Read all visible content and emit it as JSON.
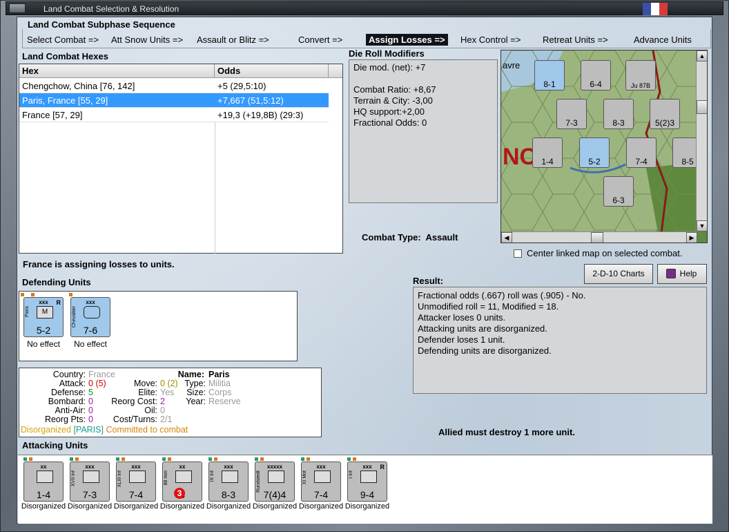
{
  "window": {
    "title": "Land Combat Selection & Resolution"
  },
  "subphase": {
    "heading": "Land Combat Subphase Sequence",
    "steps": [
      "Select Combat =>",
      "Att Snow Units =>",
      "Assault or Blitz =>",
      "Convert =>",
      "Assign Losses =>",
      "Hex Control =>",
      "Retreat Units =>",
      "Advance Units"
    ],
    "active_step": "Assign Losses =>"
  },
  "hexes": {
    "heading": "Land Combat Hexes",
    "columns": [
      "Hex",
      "Odds"
    ],
    "rows": [
      {
        "hex": "Chengchow, China [76, 142]",
        "odds": "+5 (29,5:10)"
      },
      {
        "hex": "Paris, France [55, 29]",
        "odds": "+7,667 (51,5:12)",
        "selected": true
      },
      {
        "hex": "France [57, 29]",
        "odds": "+19,3 (+19,8B) (29:3)"
      }
    ]
  },
  "modifiers": {
    "heading": "Die Roll Modifiers",
    "lines": [
      "Die mod. (net): +7",
      "",
      "Combat Ratio: +8,67",
      "Terrain & City: -3,00",
      "HQ support:+2,00",
      "Fractional Odds: 0"
    ]
  },
  "combat_type": {
    "label": "Combat Type:",
    "value": "Assault"
  },
  "center_map": {
    "label": "Center linked map on selected combat.",
    "checked": false
  },
  "assigning_text": "France is assigning losses to units.",
  "defending": {
    "heading": "Defending Units",
    "units": [
      {
        "size": "xxx",
        "name": "Paris",
        "vals": "5-2",
        "status": "No effect",
        "r": "R",
        "inner": "M"
      },
      {
        "size": "xxx",
        "name": "Chevallier",
        "vals": "7-6",
        "status": "No effect",
        "r": "",
        "inner": ""
      }
    ]
  },
  "unit_info": {
    "country_label": "Country:",
    "country": "France",
    "attack_label": "Attack:",
    "attack": "0",
    "attack_paren": "(5)",
    "defense_label": "Defense:",
    "defense": "5",
    "bombard_label": "Bombard:",
    "bombard": "0",
    "antiair_label": "Anti-Air:",
    "antiair": "0",
    "reorg_pts_label": "Reorg Pts:",
    "reorg_pts": "0",
    "name_label": "Name:",
    "name": "Paris",
    "move_label": "Move:",
    "move": "0",
    "move_paren": "(2)",
    "type_label": "Type:",
    "type": "Militia",
    "elite_label": "Elite:",
    "elite": "Yes",
    "size_label": "Size:",
    "size": "Corps",
    "reorg_cost_label": "Reorg Cost:",
    "reorg_cost": "2",
    "year_label": "Year:",
    "year": "Reserve",
    "oil_label": "Oil:",
    "oil": "0",
    "cost_turns_label": "Cost/Turns:",
    "cost_turns": "2/1",
    "status1": "Disorganized",
    "status2": "[PARIS]",
    "status3": "Committed to combat"
  },
  "buttons": {
    "charts": "2-D-10 Charts",
    "help": "Help"
  },
  "result": {
    "heading": "Result:",
    "lines": [
      "Fractional odds (.667) roll was (.905)  - No.",
      "Unmodified roll = 11, Modified = 18.",
      "Attacker loses 0 units.",
      "Attacking units are disorganized.",
      "Defender loses 1 unit.",
      "Defending units are disorganized."
    ]
  },
  "must_destroy": "Allied must destroy 1 more unit.",
  "attacking": {
    "heading": "Attacking Units",
    "units": [
      {
        "size": "xx",
        "name": "",
        "vals": "1-4",
        "status": "Disorganized"
      },
      {
        "size": "xxx",
        "name": "XVII Inf",
        "vals": "7-3",
        "status": "Disorganized"
      },
      {
        "size": "xxx",
        "name": "XLIII Inf",
        "vals": "7-4",
        "status": "Disorganized"
      },
      {
        "size": "xx",
        "name": "88 mm",
        "vals": "3",
        "badge": "3",
        "status": "Disorganized"
      },
      {
        "size": "xxx",
        "name": "IX Inf",
        "vals": "8-3",
        "status": "Disorganized"
      },
      {
        "size": "xxxxx",
        "name": "Rundstedt",
        "vals": "7(4)4",
        "status": "Disorganized"
      },
      {
        "size": "xxx",
        "name": "XI Mot",
        "vals": "7-4",
        "status": "Disorganized"
      },
      {
        "size": "xxx",
        "name": "I Inf",
        "vals": "9-4",
        "status": "Disorganized",
        "r": "R"
      }
    ]
  },
  "map": {
    "label_text": "avre",
    "big_text": "NC",
    "counters": [
      {
        "vals": "8-1"
      },
      {
        "vals": "6-4"
      },
      {
        "vals": "Ju 87B"
      },
      {
        "vals": "7-3"
      },
      {
        "vals": "8-3"
      },
      {
        "vals": "5(2)3"
      },
      {
        "vals": "1-4"
      },
      {
        "vals": "5-2"
      },
      {
        "vals": "7-4"
      },
      {
        "vals": "8-5"
      },
      {
        "vals": "6-3"
      }
    ]
  },
  "colors": {
    "selected_row": "#3399ff",
    "active_step_bg": "#101418",
    "orange": "#d4860b",
    "purple": "#9b1aa6",
    "green": "#1a8a1a",
    "red": "#cc0000"
  }
}
